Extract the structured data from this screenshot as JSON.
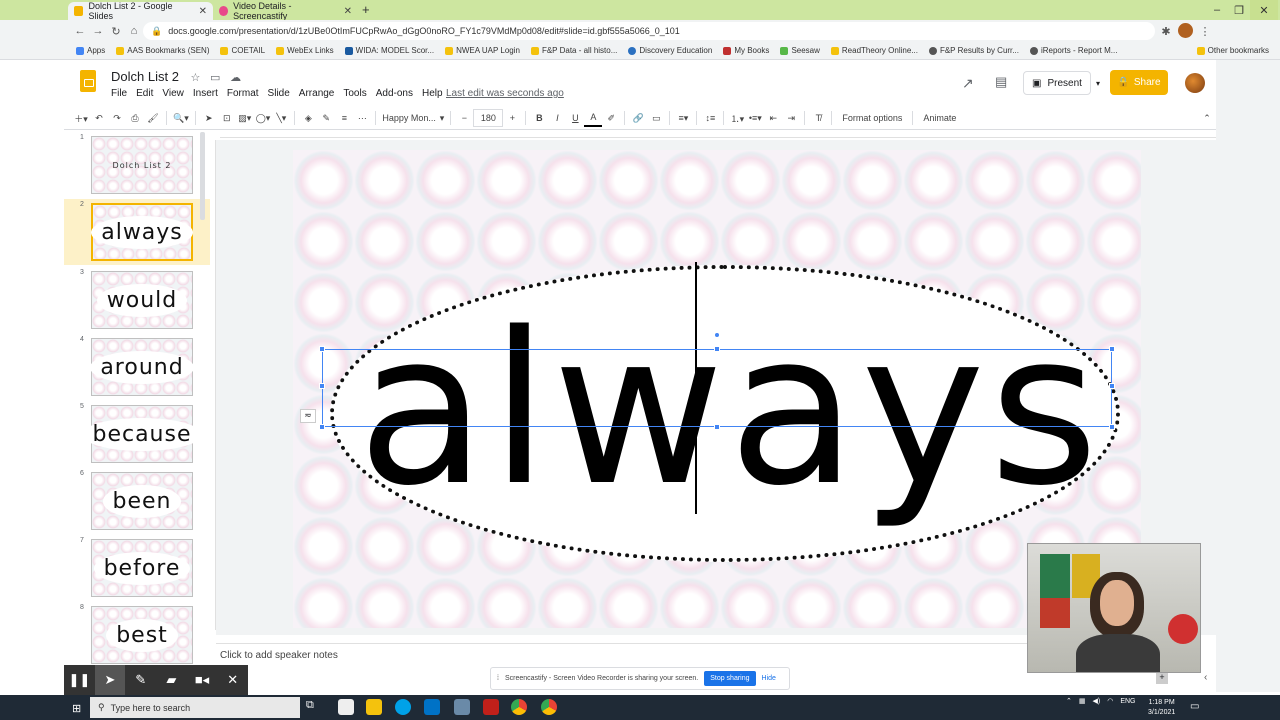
{
  "browser": {
    "tabs": [
      {
        "title": "Dolch List 2 - Google Slides",
        "active": true
      },
      {
        "title": "Video Details - Screencastify",
        "active": false
      }
    ],
    "url": "docs.google.com/presentation/d/1zUBe0OtImFUCpRwAo_dGgO0noRO_FY1c79VMdMp0d08/edit#slide=id.gbf555a5066_0_101",
    "bookmarks": [
      "Apps",
      "AAS Bookmarks (SEN)",
      "COETAIL",
      "WebEx Links",
      "WIDA: MODEL Scor...",
      "NWEA UAP Login",
      "F&P Data - all histo...",
      "Discovery Education",
      "My Books",
      "Seesaw",
      "ReadTheory Online...",
      "F&P Results by Curr...",
      "iReports - Report M..."
    ],
    "other_bookmarks": "Other bookmarks"
  },
  "app": {
    "title": "Dolch List 2",
    "menus": [
      "File",
      "Edit",
      "View",
      "Insert",
      "Format",
      "Slide",
      "Arrange",
      "Tools",
      "Add-ons",
      "Help"
    ],
    "last_edit": "Last edit was seconds ago",
    "present_label": "Present",
    "share_label": "Share"
  },
  "toolbar": {
    "font": "Happy Mon...",
    "font_size": "180",
    "format_options": "Format options",
    "animate": "Animate"
  },
  "slides": [
    {
      "num": "1",
      "text": "Dolch List 2"
    },
    {
      "num": "2",
      "text": "always"
    },
    {
      "num": "3",
      "text": "would"
    },
    {
      "num": "4",
      "text": "around"
    },
    {
      "num": "5",
      "text": "because"
    },
    {
      "num": "6",
      "text": "been"
    },
    {
      "num": "7",
      "text": "before"
    },
    {
      "num": "8",
      "text": "best"
    }
  ],
  "selected_slide": 2,
  "canvas": {
    "word": "always"
  },
  "notes_placeholder": "Click to add speaker notes",
  "screencastify": {
    "sharing_text": "Screencastify - Screen Video Recorder is sharing your screen.",
    "stop_label": "Stop sharing",
    "hide_label": "Hide"
  },
  "taskbar": {
    "search_placeholder": "Type here to search",
    "lang": "ENG",
    "time": "1:18 PM",
    "date": "3/1/2021"
  }
}
